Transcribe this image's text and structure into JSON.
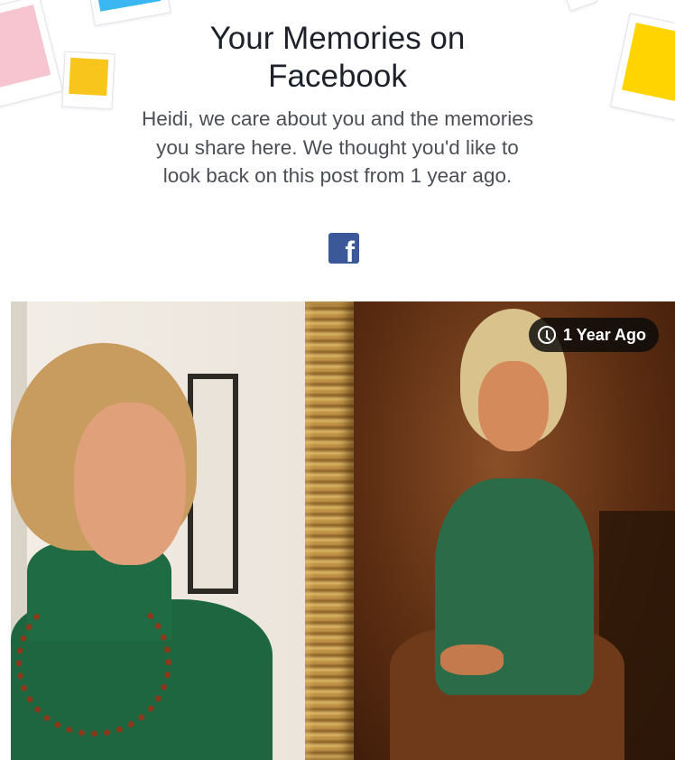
{
  "header": {
    "title": "Your Memories on Facebook",
    "message": "Heidi, we care about you and the memories you share here. We thought you'd like to look back on this post from 1 year ago."
  },
  "brand": {
    "logo_icon": "facebook-logo",
    "logo_glyph": "f",
    "color": "#3b5998"
  },
  "memory": {
    "badge_icon": "clock-icon",
    "badge_label": "1 Year Ago"
  }
}
